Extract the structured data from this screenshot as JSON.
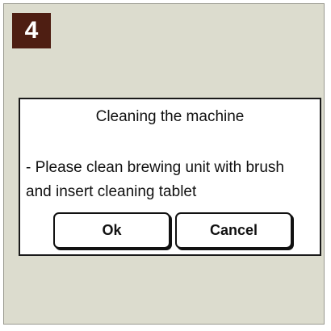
{
  "step": {
    "number": "4"
  },
  "dialog": {
    "title": "Cleaning the machine",
    "message": "- Please clean brewing unit with brush\nand insert cleaning tablet",
    "ok_label": "Ok",
    "cancel_label": "Cancel"
  },
  "colors": {
    "background": "#dcdcce",
    "badge": "#4e1e12",
    "dialog": "#ffffff"
  }
}
